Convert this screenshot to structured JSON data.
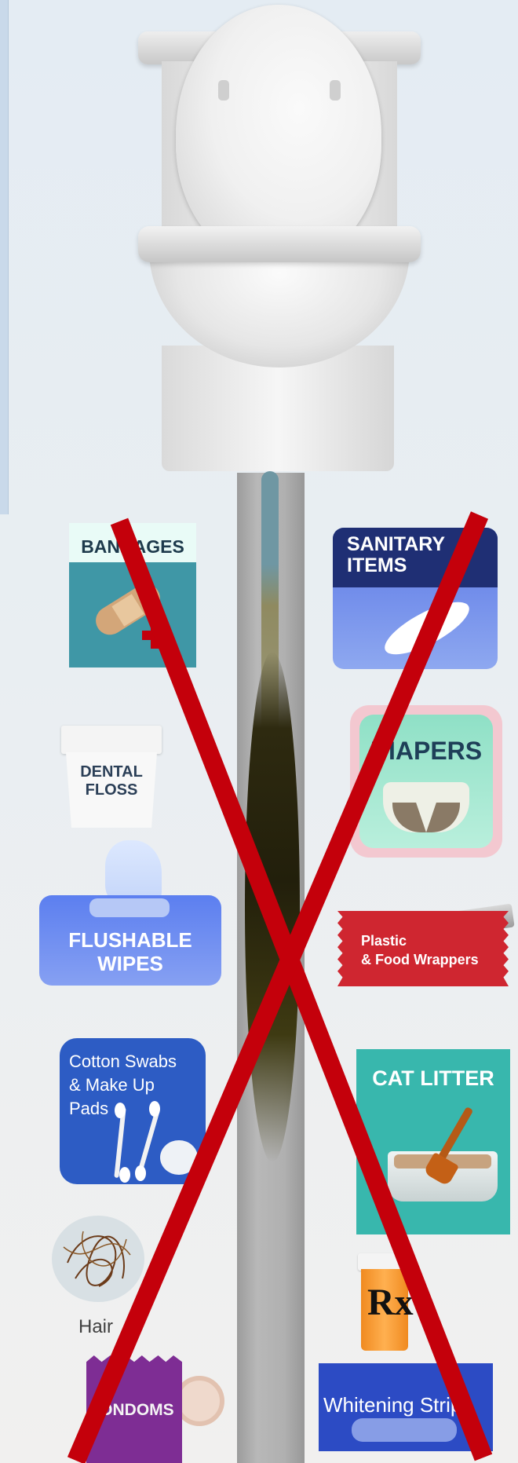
{
  "items_left": {
    "bandages": "BANDAGES",
    "dental_floss": "DENTAL\nFLOSS",
    "flushable_wipes": "FLUSHABLE\nWIPES",
    "cotton_swabs": "Cotton Swabs\n& Make Up\nPads",
    "hair": "Hair",
    "condoms": "CONDOMS"
  },
  "items_right": {
    "sanitary_items": "SANITARY\nITEMS",
    "diapers": "DIAPERS",
    "plastic_wrappers": "Plastic\n& Food Wrappers",
    "cat_litter": "CAT LITTER",
    "prescription": "Rx",
    "whitening_strips": "Whitening Strips"
  },
  "colors": {
    "cross": "#c4000b",
    "pipe": "#b0b0b0",
    "sludge": "#2a2610"
  },
  "icons": [
    "toilet-icon",
    "pipe-icon",
    "bandage-icon",
    "pad-icon",
    "floss-icon",
    "diaper-icon",
    "wipes-icon",
    "wrapper-icon",
    "swab-icon",
    "litter-box-icon",
    "hair-icon",
    "pill-bottle-icon",
    "condom-icon",
    "whitening-strip-icon",
    "cross-out-icon"
  ]
}
